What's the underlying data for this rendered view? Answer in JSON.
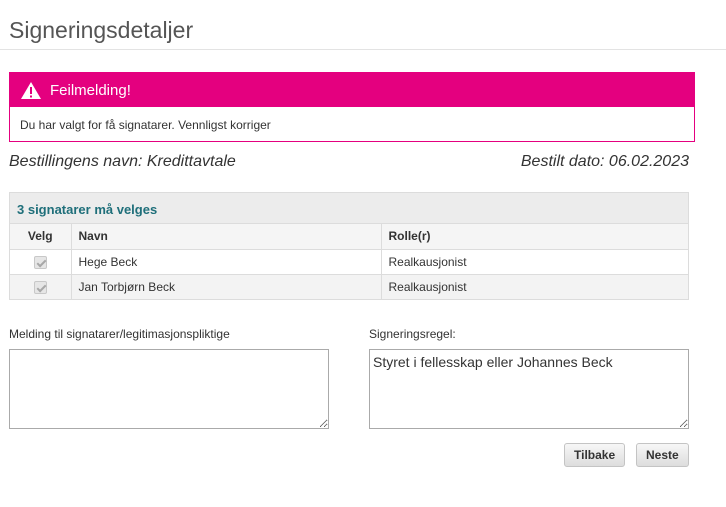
{
  "page": {
    "title": "Signeringsdetaljer"
  },
  "alert": {
    "title": "Feilmelding!",
    "message": "Du har valgt for få signatarer. Vennligst korriger",
    "color": "#e4007f",
    "icon": "warning-icon"
  },
  "order": {
    "name": "Bestillingens navn: Kredittavtale",
    "date": "Bestilt dato: 06.02.2023"
  },
  "signatories": {
    "caption": "3 signatarer må velges",
    "columns": [
      "Velg",
      "Navn",
      "Rolle(r)"
    ],
    "rows": [
      {
        "selected": true,
        "name": "Hege Beck",
        "role": "Realkausjonist"
      },
      {
        "selected": true,
        "name": "Jan Torbjørn Beck",
        "role": "Realkausjonist"
      }
    ]
  },
  "message_field": {
    "label": "Melding til signatarer/legitimasjonspliktige",
    "value": ""
  },
  "rule_field": {
    "label": "Signeringsregel:",
    "value": "Styret i fellesskap eller Johannes Beck"
  },
  "buttons": {
    "back": "Tilbake",
    "next": "Neste"
  }
}
